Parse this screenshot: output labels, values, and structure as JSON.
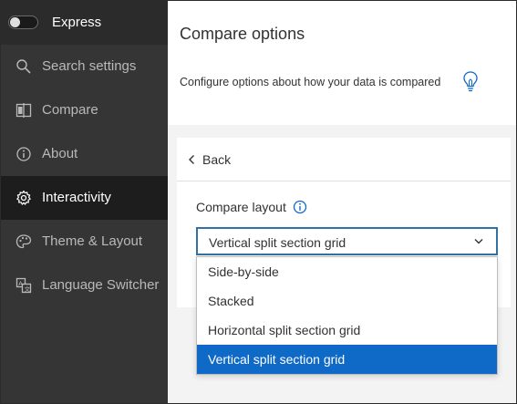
{
  "sidebar": {
    "toggle_label": "Express",
    "items": [
      {
        "label": "Search settings",
        "icon": "search-icon"
      },
      {
        "label": "Compare",
        "icon": "compare-icon"
      },
      {
        "label": "About",
        "icon": "info-icon"
      },
      {
        "label": "Interactivity",
        "icon": "gear-icon",
        "active": true
      },
      {
        "label": "Theme & Layout",
        "icon": "palette-icon"
      },
      {
        "label": "Language Switcher",
        "icon": "language-icon"
      }
    ]
  },
  "main": {
    "title": "Compare options",
    "description": "Configure options about how your data is compared",
    "back_label": "Back",
    "field_label": "Compare layout",
    "select_value": "Vertical split section grid",
    "options": [
      "Side-by-side",
      "Stacked",
      "Horizontal split section grid",
      "Vertical split section grid"
    ]
  },
  "colors": {
    "sidebar_bg": "#353535",
    "active_bg": "#1d1d1d",
    "accent": "#0f69c7",
    "select_border": "#3271a5"
  }
}
